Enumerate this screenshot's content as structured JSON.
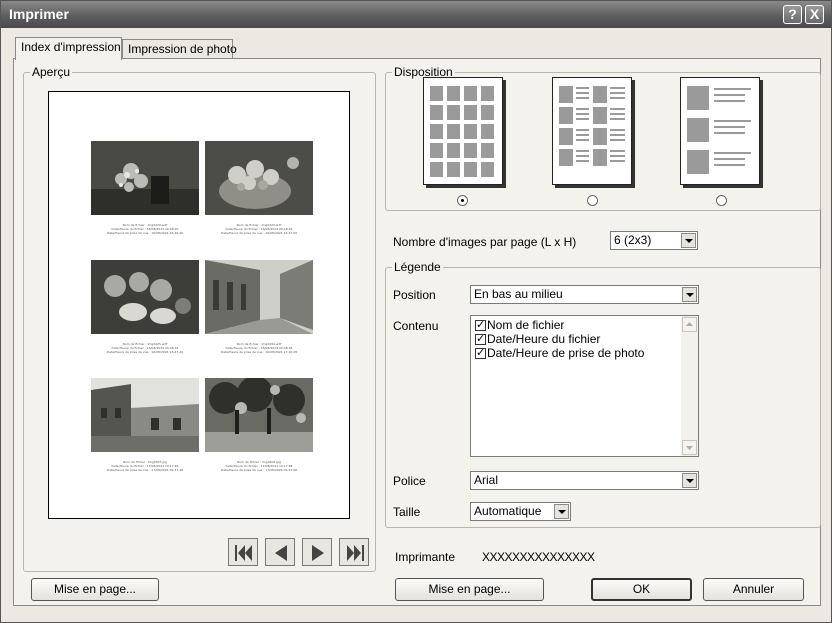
{
  "window": {
    "title": "Imprimer",
    "help_glyph": "?",
    "close_glyph": "X"
  },
  "tabs": [
    {
      "label": "Index d'impression",
      "active": true
    },
    {
      "label": "Impression de photo",
      "active": false
    }
  ],
  "preview": {
    "group_label": "Aperçu",
    "photos": [
      {
        "theme": "bouquet",
        "caption": [
          "Nom de fichier : Img0220.wdf",
          "Date/Heure du fichier : 16/08/2024 20:48:20",
          "Date/Heure de prise de vue : 16/08/2024 16:46:40"
        ]
      },
      {
        "theme": "fruit-bowl",
        "caption": [
          "Nom de fichier : Img0223.wdf",
          "Date/Heure du fichier : 16/08/2024 20:48:10",
          "Date/Heure de prise de vue : 16/08/2024 16:47:09"
        ]
      },
      {
        "theme": "fruits",
        "caption": [
          "Nom de fichier : Img0225.wdf",
          "Date/Heure du fichier : 16/08/2024 20:48:32",
          "Date/Heure de prise de vue : 16/08/2024 16:47:40"
        ]
      },
      {
        "theme": "street",
        "caption": [
          "Nom de fichier : Img0294.wdf",
          "Date/Heure du fichier : 16/08/2024 20:48:36",
          "Date/Heure de prise de vue : 16/08/2024 17:10:28"
        ]
      },
      {
        "theme": "church",
        "caption": [
          "Nom de fichier : Img0307.jpg",
          "Date/Heure du fichier : 17/08/2024 10:17:46",
          "Date/Heure de prise de vue : 17/08/2024 09:37:48"
        ]
      },
      {
        "theme": "trees",
        "caption": [
          "Nom de fichier : Img0402.jpg",
          "Date/Heure du fichier : 17/08/2024 10:17:48",
          "Date/Heure de prise de vue : 17/08/2024 09:41:06"
        ]
      }
    ],
    "nav_icons": [
      "first-page-icon",
      "prev-page-icon",
      "next-page-icon",
      "last-page-icon"
    ],
    "page_setup_button": "Mise en page..."
  },
  "disposition": {
    "group_label": "Disposition",
    "options": [
      "grid",
      "list",
      "details"
    ],
    "selected_index": 0
  },
  "images_per_page": {
    "label": "Nombre d'images par page (L x H)",
    "value": "6 (2x3)"
  },
  "legend": {
    "group_label": "Légende",
    "position_label": "Position",
    "position_value": "En bas au milieu",
    "content_label": "Contenu",
    "content_items": [
      {
        "label": "Nom de fichier",
        "checked": true
      },
      {
        "label": "Date/Heure du fichier",
        "checked": true
      },
      {
        "label": "Date/Heure de prise de photo",
        "checked": true
      }
    ],
    "font_label": "Police",
    "font_value": "Arial",
    "size_label": "Taille",
    "size_value": "Automatique"
  },
  "printer": {
    "label": "Imprimante",
    "value": "XXXXXXXXXXXXXXX"
  },
  "buttons": {
    "page_setup": "Mise en page...",
    "ok": "OK",
    "cancel": "Annuler"
  },
  "colors": {
    "titlebar": "#5e5e5e",
    "panel": "#f4f2ec",
    "dialog": "#ece9e2"
  }
}
